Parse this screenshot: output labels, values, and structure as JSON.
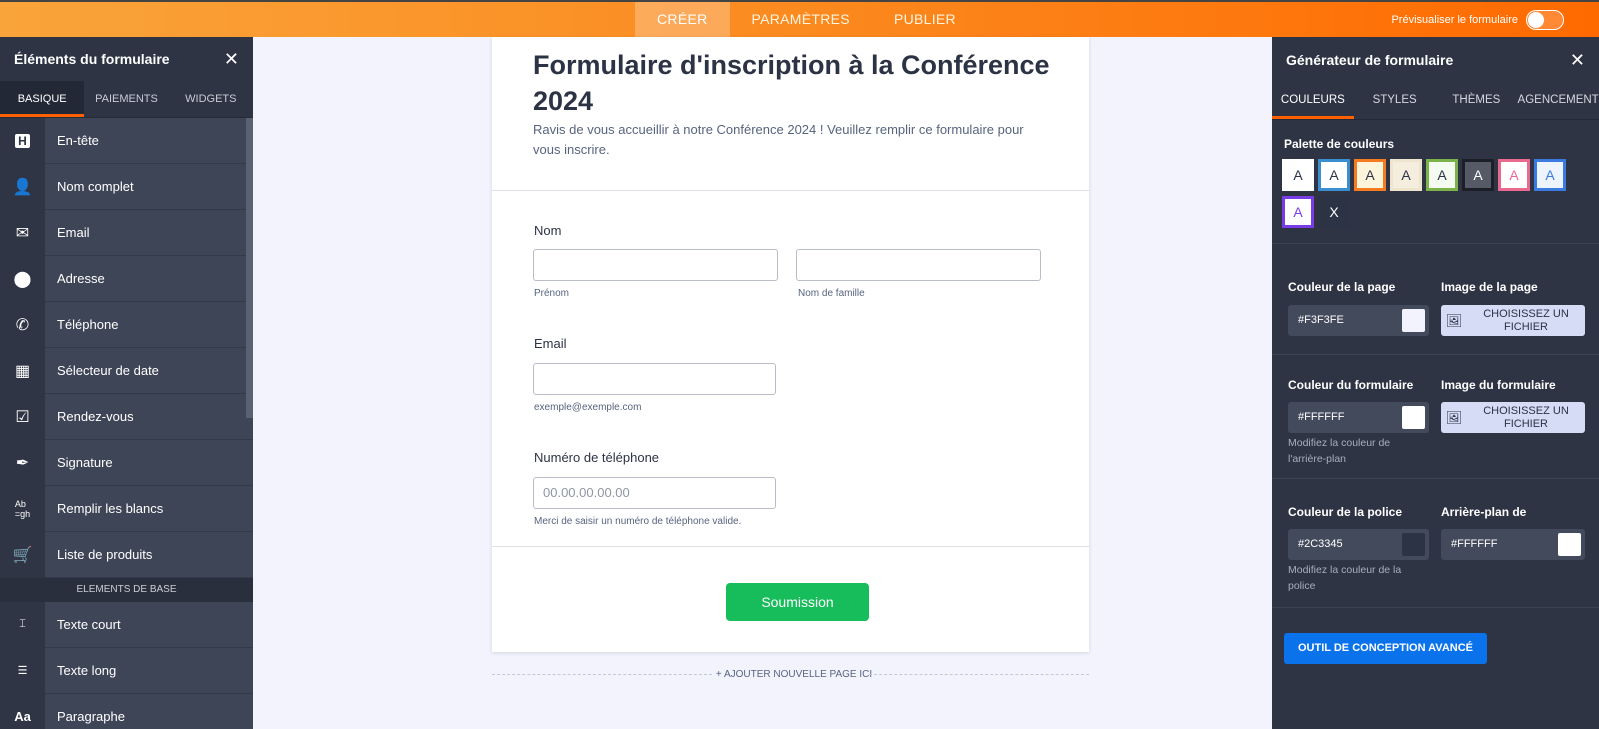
{
  "topbar": {
    "tabs": [
      "CRÉER",
      "PARAMÈTRES",
      "PUBLIER"
    ],
    "preview_label": "Prévisualiser le formulaire"
  },
  "left": {
    "title": "Éléments du formulaire",
    "tabs": [
      "BASIQUE",
      "PAIEMENTS",
      "WIDGETS"
    ],
    "items": [
      {
        "label": "En-tête",
        "icon": "heading-icon"
      },
      {
        "label": "Nom complet",
        "icon": "user-icon"
      },
      {
        "label": "Email",
        "icon": "mail-icon"
      },
      {
        "label": "Adresse",
        "icon": "location-icon"
      },
      {
        "label": "Téléphone",
        "icon": "phone-icon"
      },
      {
        "label": "Sélecteur de date",
        "icon": "calendar-icon"
      },
      {
        "label": "Rendez-vous",
        "icon": "calendar-check-icon"
      },
      {
        "label": "Signature",
        "icon": "pen-icon"
      },
      {
        "label": "Remplir les blancs",
        "icon": "fill-blanks-icon"
      },
      {
        "label": "Liste de produits",
        "icon": "cart-icon"
      }
    ],
    "section_label": "ELEMENTS DE BASE",
    "items2": [
      {
        "label": "Texte court",
        "icon": "short-text-icon"
      },
      {
        "label": "Texte long",
        "icon": "long-text-icon"
      },
      {
        "label": "Paragraphe",
        "icon": "paragraph-icon"
      }
    ]
  },
  "form": {
    "title": "Formulaire d'inscription à la Conférence 2024",
    "description": "Ravis de vous accueillir à notre Conférence 2024 ! Veuillez remplir ce formulaire pour vous inscrire.",
    "name_label": "Nom",
    "first_sub": "Prénom",
    "last_sub": "Nom de famille",
    "email_label": "Email",
    "email_sub": "exemple@exemple.com",
    "phone_label": "Numéro de téléphone",
    "phone_placeholder": "00.00.00.00.00",
    "phone_sub": "Merci de saisir un numéro de téléphone valide.",
    "submit_label": "Soumission",
    "add_page_label": "+ AJOUTER NOUVELLE PAGE ICI"
  },
  "right": {
    "title": "Générateur de formulaire",
    "tabs": [
      "COULEURS",
      "STYLES",
      "THÈMES",
      "AGENCEMENT"
    ],
    "palette_label": "Palette de couleurs",
    "palette": [
      {
        "text": "A",
        "bg": "#ffffff",
        "border": "#ffffff",
        "fg": "#2c3345"
      },
      {
        "text": "A",
        "bg": "#ffffff",
        "border": "#3b8fd0",
        "fg": "#2c3345"
      },
      {
        "text": "A",
        "bg": "#fdf4dc",
        "border": "#f47b20",
        "fg": "#2c3345"
      },
      {
        "text": "A",
        "bg": "#f5eedf",
        "border": "#efe4cd",
        "fg": "#2c3345"
      },
      {
        "text": "A",
        "bg": "#f4fbf0",
        "border": "#7bb34a",
        "fg": "#2c3345"
      },
      {
        "text": "A",
        "bg": "#555a66",
        "border": "#1c1f27",
        "fg": "#ffffff"
      },
      {
        "text": "A",
        "bg": "#ffffff",
        "border": "#e9698f",
        "fg": "#e9698f"
      },
      {
        "text": "A",
        "bg": "#eef4fd",
        "border": "#3b7be0",
        "fg": "#3b7be0"
      },
      {
        "text": "A",
        "bg": "#ffffff",
        "border": "#7a3ce6",
        "fg": "#7a3ce6"
      },
      {
        "text": "X",
        "bg": "#2c3345",
        "border": "#2c3345",
        "fg": "#ffffff"
      }
    ],
    "page_color_label": "Couleur de la page",
    "page_color": "#F3F3FE",
    "page_image_label": "Image de la page",
    "choose_file": "CHOISISSEZ UN FICHIER",
    "form_color_label": "Couleur du formulaire",
    "form_color": "#FFFFFF",
    "form_image_label": "Image du formulaire",
    "form_color_hint": "Modifiez la couleur de l'arrière-plan",
    "font_color_label": "Couleur de la police",
    "font_color": "#2C3345",
    "bg_label": "Arrière-plan de",
    "bg_color": "#FFFFFF",
    "font_color_hint": "Modifiez la couleur de la police",
    "advanced_button": "OUTIL DE CONCEPTION AVANCÉ"
  }
}
